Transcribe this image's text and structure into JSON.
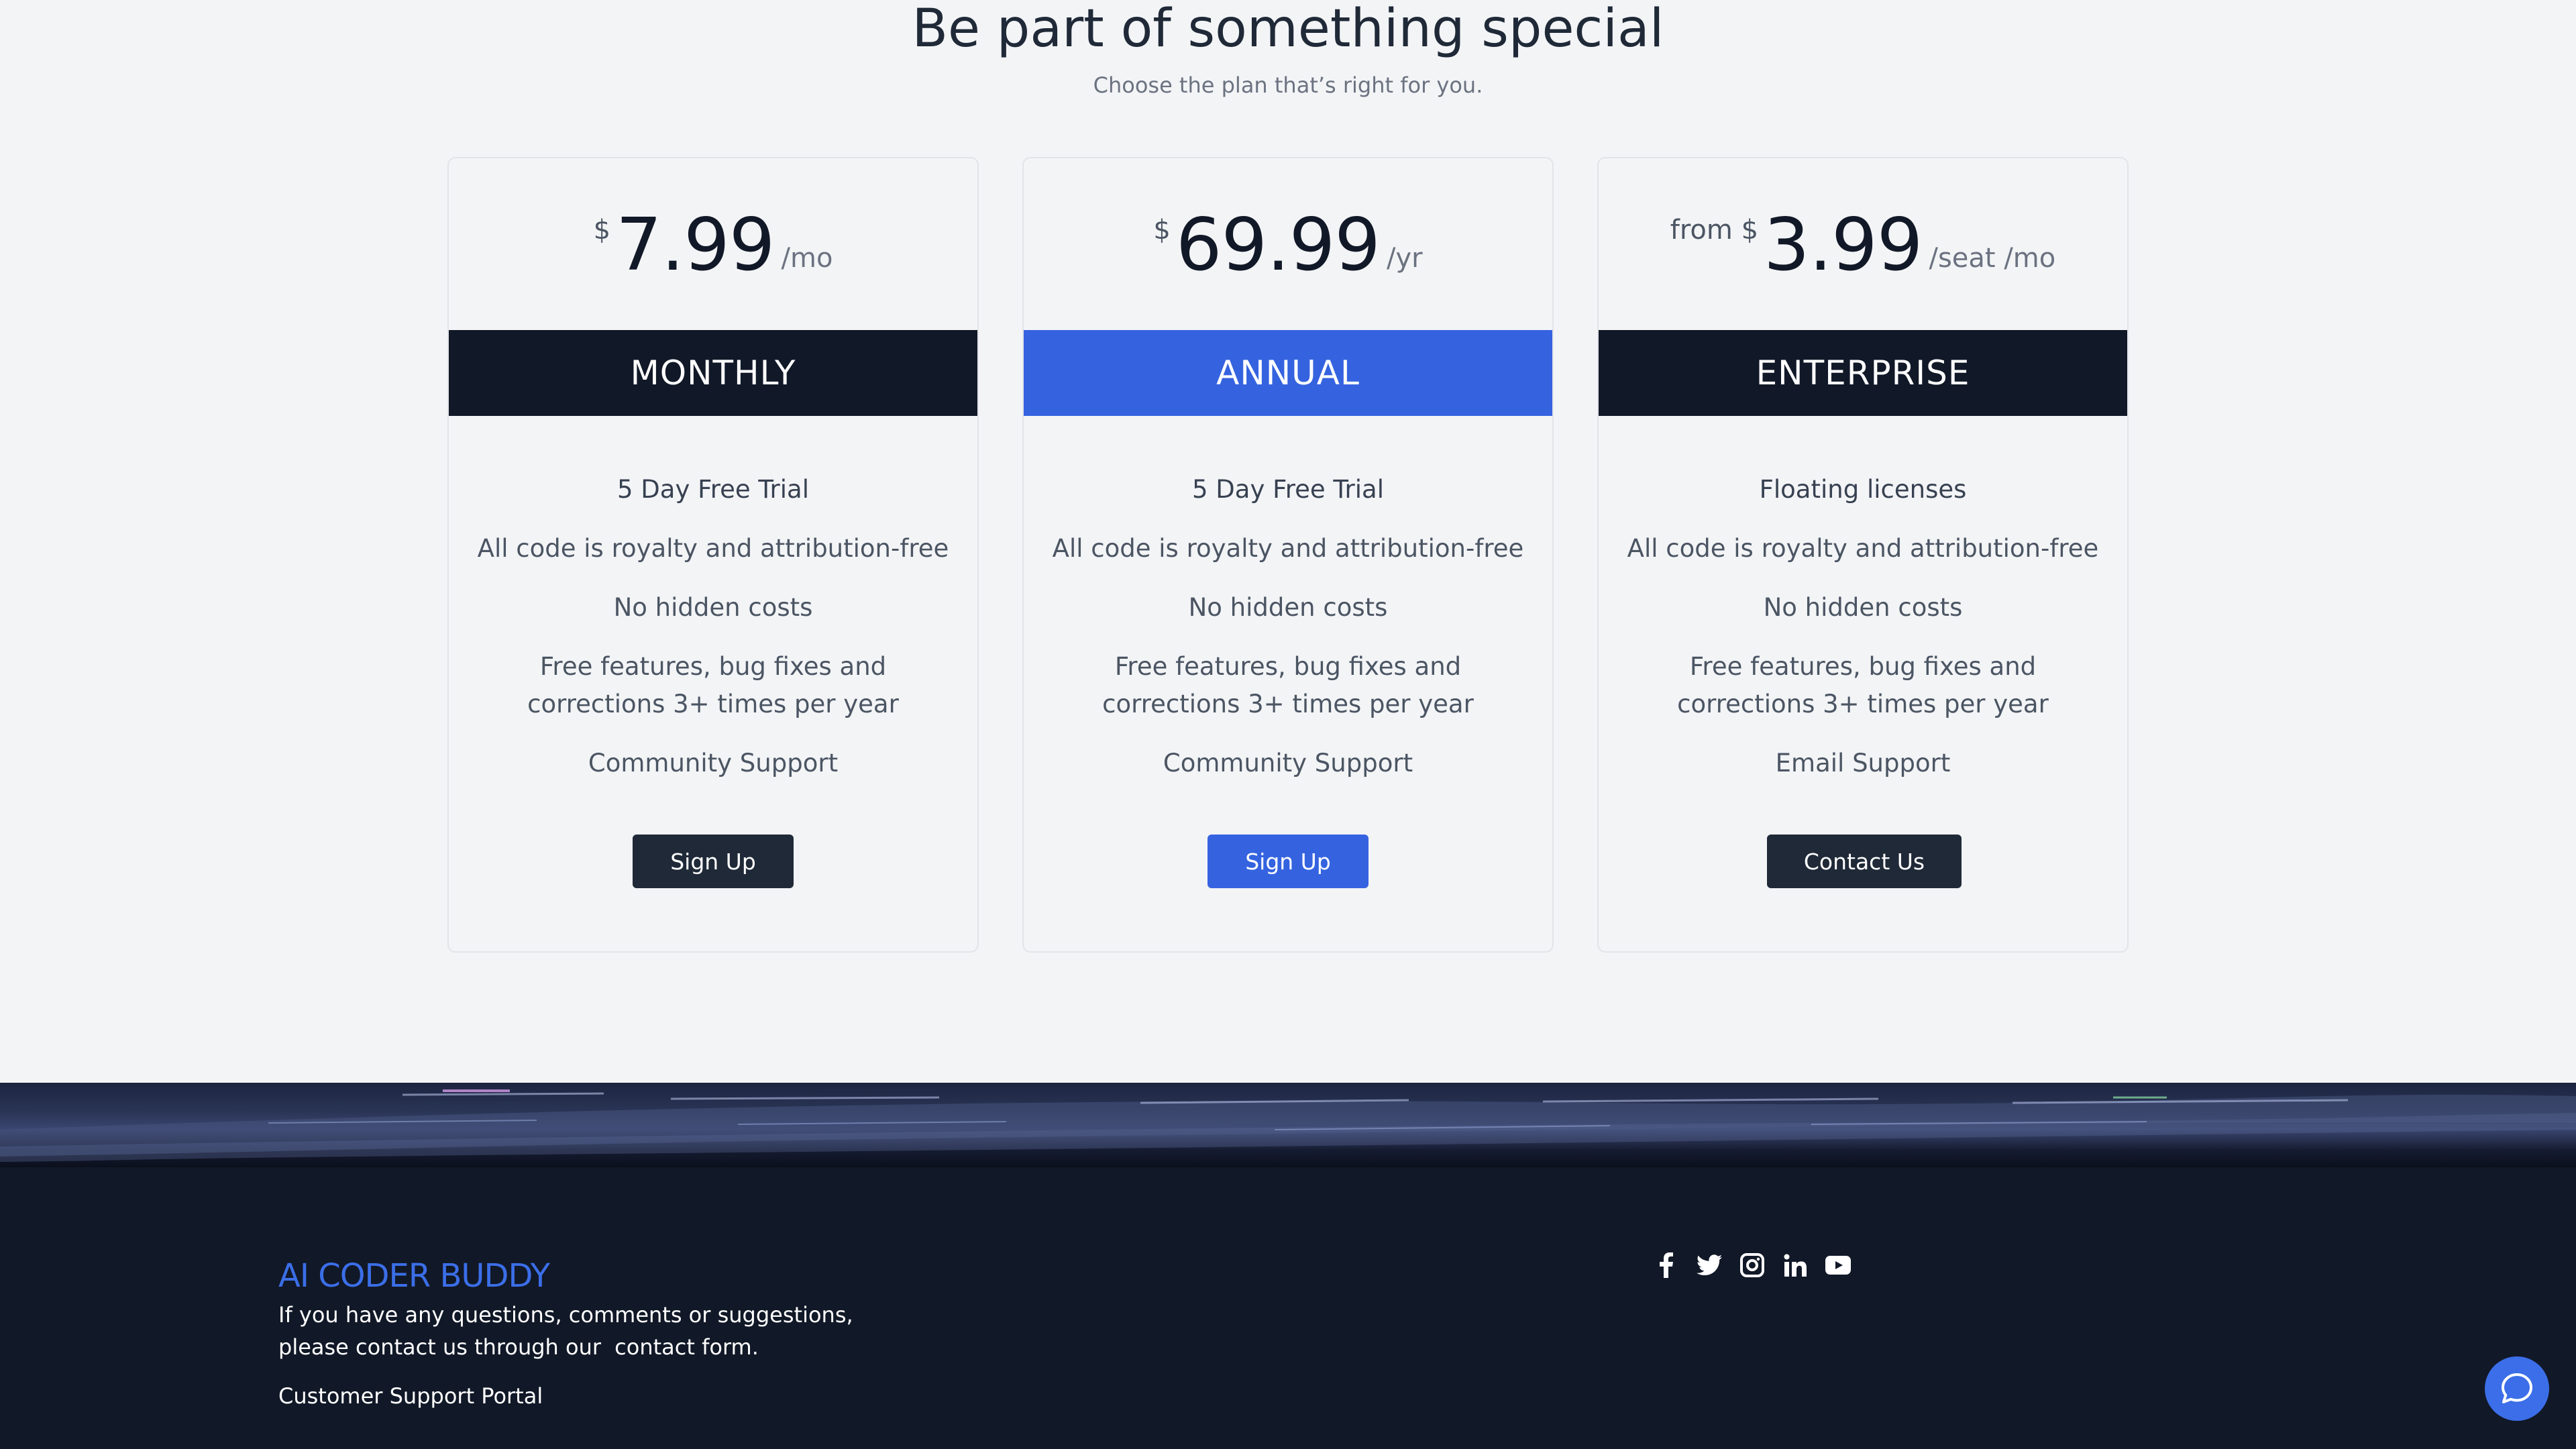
{
  "hero": {
    "title": "Be part of something special",
    "subtitle": "Choose the plan that’s right for you."
  },
  "plans": [
    {
      "prefix": "$",
      "amount": "7.99",
      "period": "/mo",
      "name": "MONTHLY",
      "features": [
        "5 Day Free Trial",
        "All code is royalty and attribution-free",
        "No hidden costs",
        "Free features, bug fixes and corrections 3+ times per year",
        "Community Support"
      ],
      "cta": "Sign Up"
    },
    {
      "prefix": "$",
      "amount": "69.99",
      "period": "/yr",
      "name": "ANNUAL",
      "features": [
        "5 Day Free Trial",
        "All code is royalty and attribution-free",
        "No hidden costs",
        "Free features, bug fixes and corrections 3+ times per year",
        "Community Support"
      ],
      "cta": "Sign Up"
    },
    {
      "prefix": "from $",
      "amount": "3.99",
      "period": "/seat /mo",
      "name": "ENTERPRISE",
      "features": [
        "Floating licenses",
        "All code is royalty and attribution-free",
        "No hidden costs",
        "Free features, bug fixes and corrections 3+ times per year",
        "Email Support"
      ],
      "cta": "Contact Us"
    }
  ],
  "footer": {
    "brand": "AI CODER BUDDY",
    "contact_text": "If you have any questions, comments or suggestions, please contact us through our",
    "contact_link": "contact form.",
    "support_link": "Customer Support Portal",
    "socials": [
      "facebook-icon",
      "twitter-icon",
      "instagram-icon",
      "linkedin-icon",
      "youtube-icon"
    ]
  },
  "colors": {
    "accent": "#3563e0",
    "dark": "#111827",
    "brand": "#3b6ee8"
  }
}
